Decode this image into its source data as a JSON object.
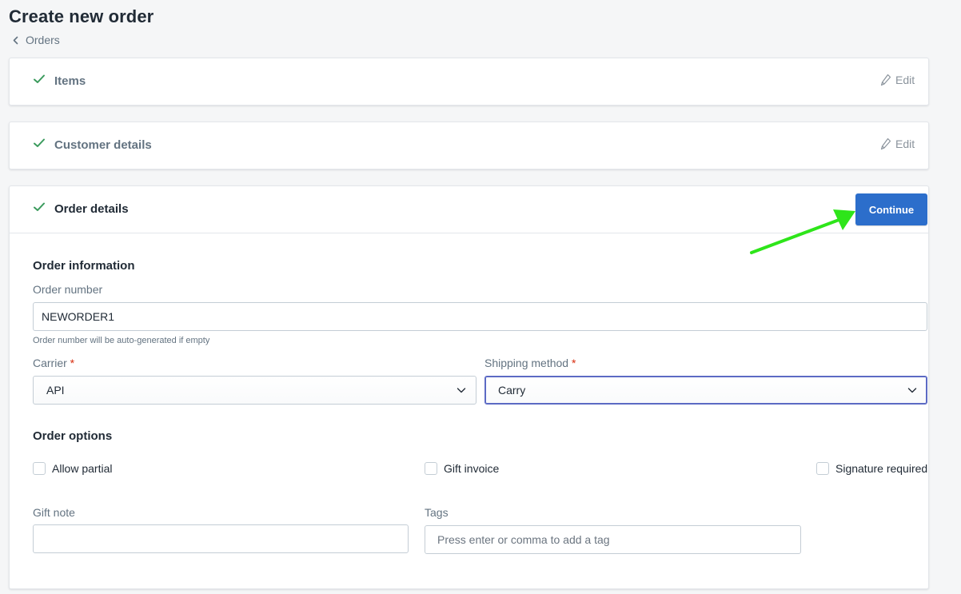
{
  "page": {
    "title": "Create new order",
    "breadcrumb": "Orders"
  },
  "steps": {
    "items": {
      "title": "Items",
      "edit_label": "Edit"
    },
    "customer": {
      "title": "Customer details",
      "edit_label": "Edit"
    },
    "order": {
      "title": "Order details",
      "continue_label": "Continue"
    }
  },
  "order_information": {
    "title": "Order information",
    "order_number": {
      "label": "Order number",
      "value": "NEWORDER1",
      "help": "Order number will be auto-generated if empty"
    },
    "carrier": {
      "label": "Carrier",
      "required_mark": "*",
      "value": "API"
    },
    "shipping_method": {
      "label": "Shipping method",
      "required_mark": "*",
      "value": "Carry"
    }
  },
  "order_options": {
    "title": "Order options",
    "allow_partial": "Allow partial",
    "gift_invoice": "Gift invoice",
    "signature_required": "Signature required",
    "gift_note": {
      "label": "Gift note",
      "value": ""
    },
    "tags": {
      "label": "Tags",
      "placeholder": "Press enter or comma to add a tag"
    }
  },
  "colors": {
    "accent": "#2c6ecb",
    "check": "#3a9a5c",
    "annotation_arrow": "#2ee51a",
    "required": "#d82c0d"
  }
}
